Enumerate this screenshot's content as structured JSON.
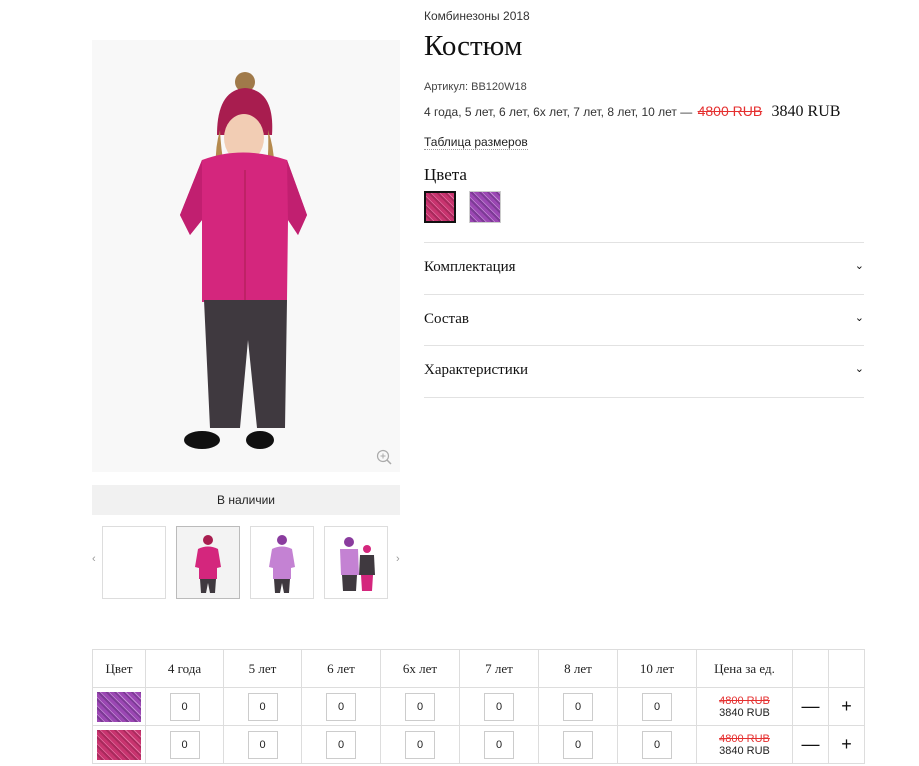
{
  "breadcrumb": "Комбинезоны 2018",
  "product": {
    "title": "Костюм",
    "sku": "Артикул: BB120W18",
    "sizes_text": "4 года, 5 лет, 6 лет, 6х лет, 7 лет, 8 лет, 10 лет —",
    "old_price": "4800 RUB",
    "new_price": "3840 RUB",
    "size_table_link": "Таблица размеров",
    "colors_heading": "Цвета",
    "stock_status": "В наличии"
  },
  "accordion": [
    {
      "label": "Комплектация"
    },
    {
      "label": "Состав"
    },
    {
      "label": "Характеристики"
    }
  ],
  "icons": {
    "zoom": "zoom-icon",
    "thumb_prev": "‹",
    "thumb_next": "›",
    "chevron": "⌄"
  },
  "colors": {
    "accent_red": "#e53030",
    "pink": "#d4267d",
    "purple": "#9b47b3"
  },
  "order_table": {
    "headers": [
      "Цвет",
      "4 года",
      "5 лет",
      "6 лет",
      "6х лет",
      "7 лет",
      "8 лет",
      "10 лет",
      "Цена за ед.",
      ""
    ],
    "rows": [
      {
        "qty": [
          "0",
          "0",
          "0",
          "0",
          "0",
          "0",
          "0"
        ],
        "old_price": "4800 RUB",
        "new_price": "3840 RUB",
        "minus": "—",
        "plus": "+"
      },
      {
        "qty": [
          "0",
          "0",
          "0",
          "0",
          "0",
          "0",
          "0"
        ],
        "old_price": "4800 RUB",
        "new_price": "3840 RUB",
        "minus": "—",
        "plus": "+"
      }
    ]
  }
}
